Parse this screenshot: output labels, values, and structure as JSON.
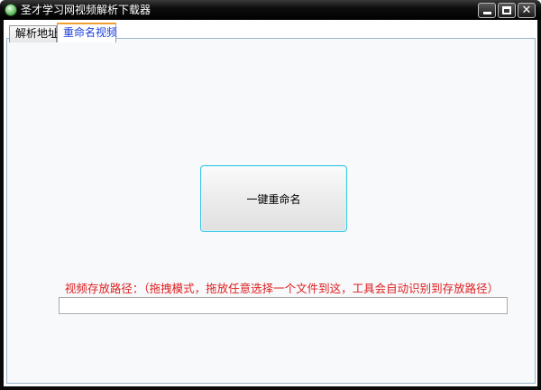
{
  "window": {
    "title": "圣才学习网视频解析下载器",
    "icon": "app-globe-icon",
    "controls": {
      "minimize": "minimize-icon",
      "maximize": "maximize-icon",
      "close_glyph": "✕"
    }
  },
  "tabs": [
    {
      "label": "解析地址",
      "selected": false
    },
    {
      "label": "重命名视频",
      "selected": true
    }
  ],
  "main": {
    "rename_button_label": "一键重命名",
    "path_label": "视频存放路径：（拖拽模式，拖放任意选择一个文件到这，工具会自动识别到存放路径）",
    "path_value": "",
    "path_placeholder": ""
  },
  "colors": {
    "tab_selected_text": "#1a3cd8",
    "path_label": "#e02020",
    "button_border": "#3cc9e4"
  }
}
